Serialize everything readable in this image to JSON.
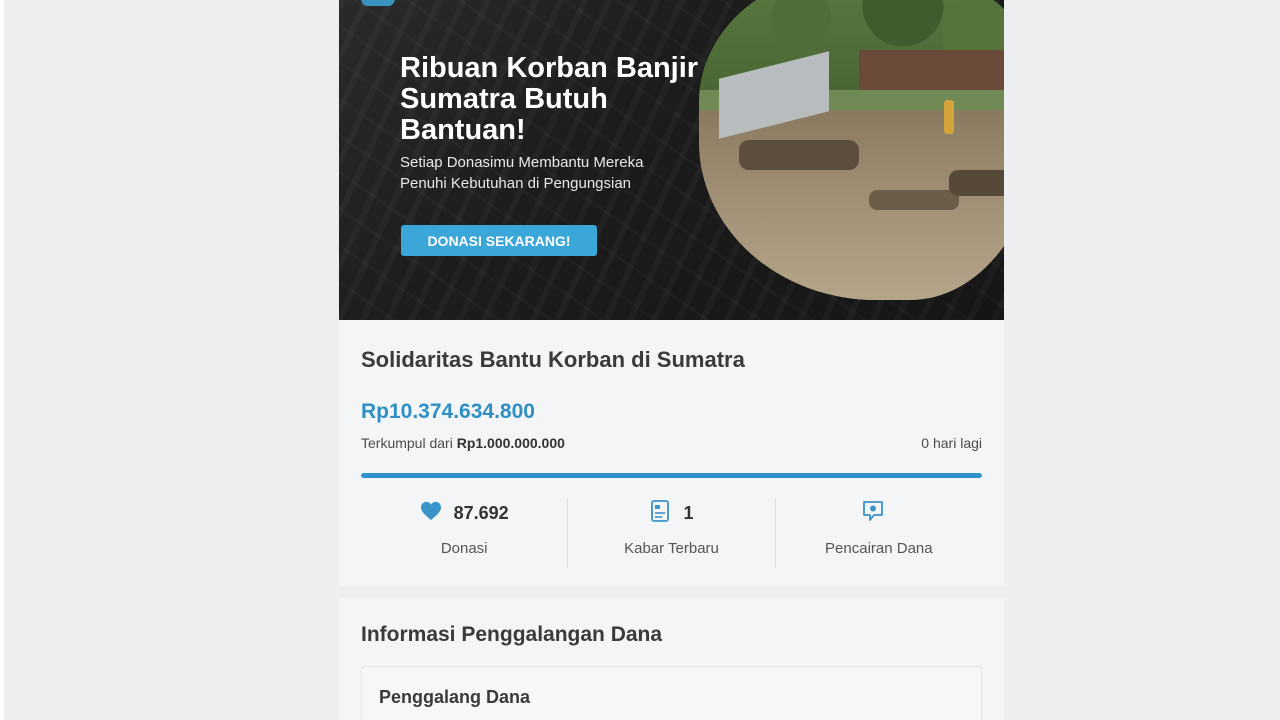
{
  "banner": {
    "title": "Ribuan Korban Banjir Sumatra Butuh Bantuan!",
    "subtitle": "Setiap Donasimu Membantu Mereka Penuhi Kebutuhan di Pengungsian",
    "cta_label": "DONASI SEKARANG!"
  },
  "campaign": {
    "title": "Solidaritas Bantu Korban di Sumatra",
    "amount": "Rp10.374.634.800",
    "collected_prefix": "Terkumpul dari",
    "target": "Rp1.000.000.000",
    "days_left": "0 hari lagi",
    "progress_percent": 100
  },
  "stats": [
    {
      "icon": "heart-icon",
      "value": "87.692",
      "label": "Donasi"
    },
    {
      "icon": "document-icon",
      "value": "1",
      "label": "Kabar Terbaru"
    },
    {
      "icon": "money-chat-icon",
      "value": "",
      "label": "Pencairan Dana"
    }
  ],
  "info": {
    "section_title": "Informasi Penggalangan Dana",
    "fundraiser_title": "Penggalang Dana"
  },
  "colors": {
    "accent": "#2e8fc4",
    "cta": "#3ba6d8",
    "heart": "#3a93c9"
  }
}
